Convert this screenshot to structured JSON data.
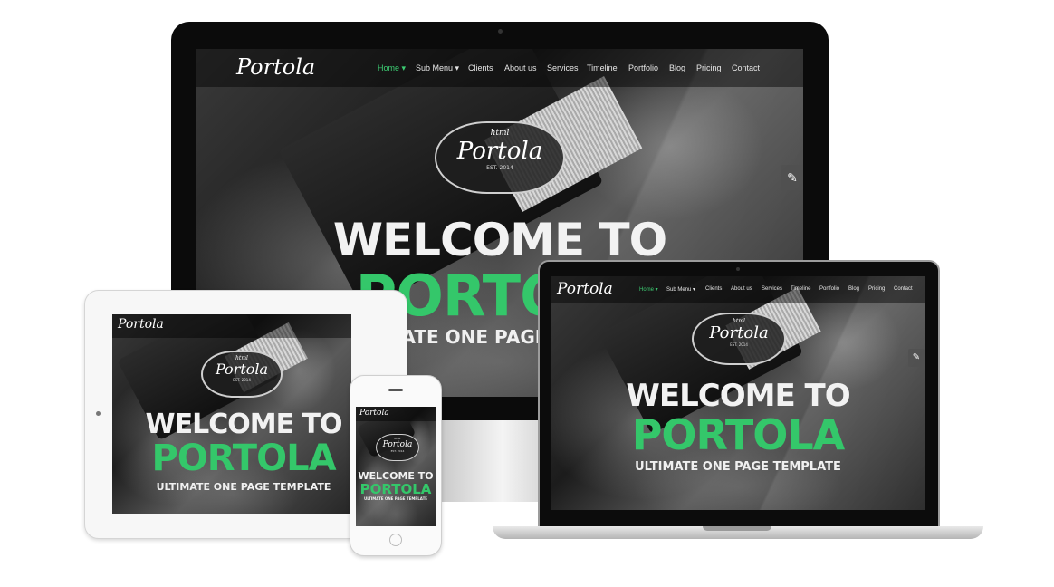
{
  "site": {
    "logo": "Portola",
    "nav": [
      "Home",
      "Sub Menu",
      "Clients",
      "About us",
      "Services",
      "Timeline",
      "Portfolio",
      "Blog",
      "Pricing",
      "Contact"
    ],
    "badge": {
      "small": "html",
      "title": "Portola",
      "est": "EST. 2014"
    },
    "hero": {
      "line1": "WELCOME TO",
      "line2": "PORTOLA",
      "line3": "ULTIMATE ONE PAGE TEMPLATE"
    }
  },
  "icons": {
    "settings": "wrench-icon",
    "menu": "hamburger-icon"
  },
  "colors": {
    "accent": "#34c76a",
    "device_dark": "#0b0b0b",
    "device_light": "#f7f7f7"
  }
}
